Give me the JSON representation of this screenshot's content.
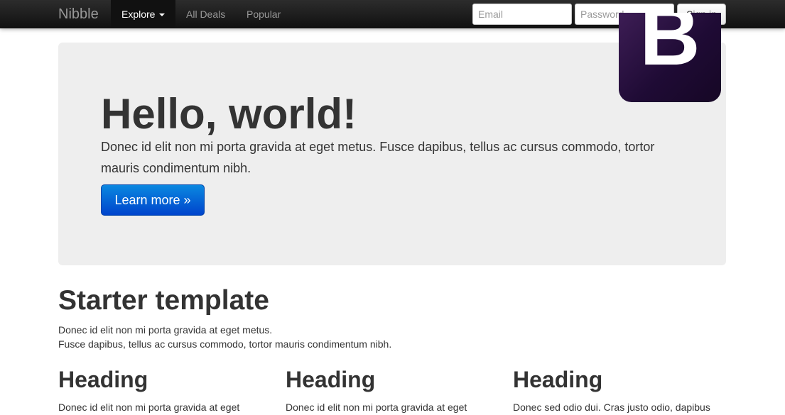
{
  "navbar": {
    "brand": "Nibble",
    "items": [
      {
        "label": "Explore"
      },
      {
        "label": "All Deals"
      },
      {
        "label": "Popular"
      }
    ],
    "email_placeholder": "Email",
    "password_placeholder": "Password",
    "signin_label": "Sign in"
  },
  "logo": {
    "letter": "B"
  },
  "hero": {
    "title": "Hello, world!",
    "text": "Donec id elit non mi porta gravida at eget metus. Fusce dapibus, tellus ac cursus commodo, tortor mauris condimentum nibh.",
    "button_label": "Learn more »"
  },
  "section": {
    "title": "Starter template",
    "line1": "Donec id elit non mi porta gravida at eget metus.",
    "line2": "Fusce dapibus, tellus ac cursus commodo, tortor mauris condimentum nibh."
  },
  "columns": [
    {
      "heading": "Heading",
      "text": "Donec id elit non mi porta gravida at eget"
    },
    {
      "heading": "Heading",
      "text": "Donec id elit non mi porta gravida at eget"
    },
    {
      "heading": "Heading",
      "text": "Donec sed odio dui. Cras justo odio, dapibus"
    }
  ],
  "colors": {
    "navbar": "#1b1b1b",
    "hero_background": "#eeeeee",
    "primary_button": "#0066cc",
    "logo": "#2b1242"
  }
}
